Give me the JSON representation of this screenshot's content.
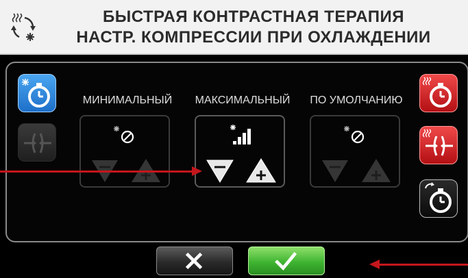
{
  "header": {
    "title_line1": "БЫСТРАЯ КОНТРАСТНАЯ ТЕРАПИЯ",
    "title_line2": "НАСТР. КОМПРЕССИИ ПРИ ОХЛАЖДЕНИИ",
    "icon": "hot-cold-cycle-icon"
  },
  "columns": [
    {
      "label": "МИНИМАЛЬНЫЙ",
      "status_icon": "compression-off-icon",
      "enabled": false
    },
    {
      "label": "МАКСИМАЛЬНЫЙ",
      "status_icon": "signal-bars-icon",
      "enabled": true
    },
    {
      "label": "ПО УМОЛЧАНИЮ",
      "status_icon": "compression-off-icon",
      "enabled": false
    }
  ],
  "left_buttons": [
    {
      "icon": "cold-timer-icon",
      "state": "active",
      "color": "#2a86dc"
    },
    {
      "icon": "compression-icon",
      "state": "disabled",
      "color": "#3a3a3a"
    }
  ],
  "right_buttons": [
    {
      "icon": "heat-timer-icon",
      "color": "#d42024"
    },
    {
      "icon": "heat-compression-icon",
      "color": "#d42024"
    },
    {
      "icon": "cycle-timer-icon",
      "color": "#1a1a1a"
    }
  ],
  "bottom": {
    "cancel_icon": "close-icon",
    "confirm_icon": "checkmark-icon"
  },
  "colors": {
    "accent_blue": "#2a86dc",
    "accent_red": "#d42024",
    "confirm_green": "#3fb431",
    "annotation_red": "#c4161c"
  }
}
